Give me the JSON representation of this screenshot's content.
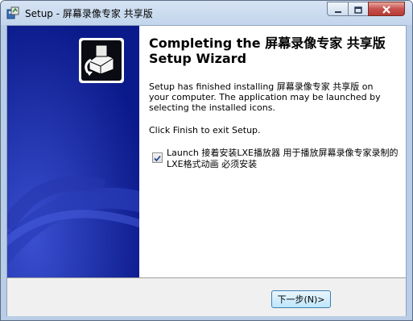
{
  "window": {
    "title": "Setup - 屏幕录像专家 共享版"
  },
  "titlebar_buttons": {
    "minimize_icon": "minimize-icon",
    "maximize_icon": "maximize-icon",
    "close_icon": "close-icon"
  },
  "wizard": {
    "heading": "Completing the 屏幕录像专家 共享版 Setup Wizard",
    "body": "Setup has finished installing 屏幕录像专家 共享版 on your computer. The application may be launched by selecting the installed icons.",
    "finish_hint": "Click Finish to exit Setup.",
    "launch_option": {
      "label": "Launch 接着安装LXE播放器 用于播放屏幕录像专家录制的LXE格式动画 必须安装",
      "checked": true
    }
  },
  "footer": {
    "next_label": "下一步(N)>"
  },
  "colors": {
    "side_panel": "#0b1a8a",
    "titlebar": "#c2d5ec",
    "close_button": "#c75050"
  }
}
